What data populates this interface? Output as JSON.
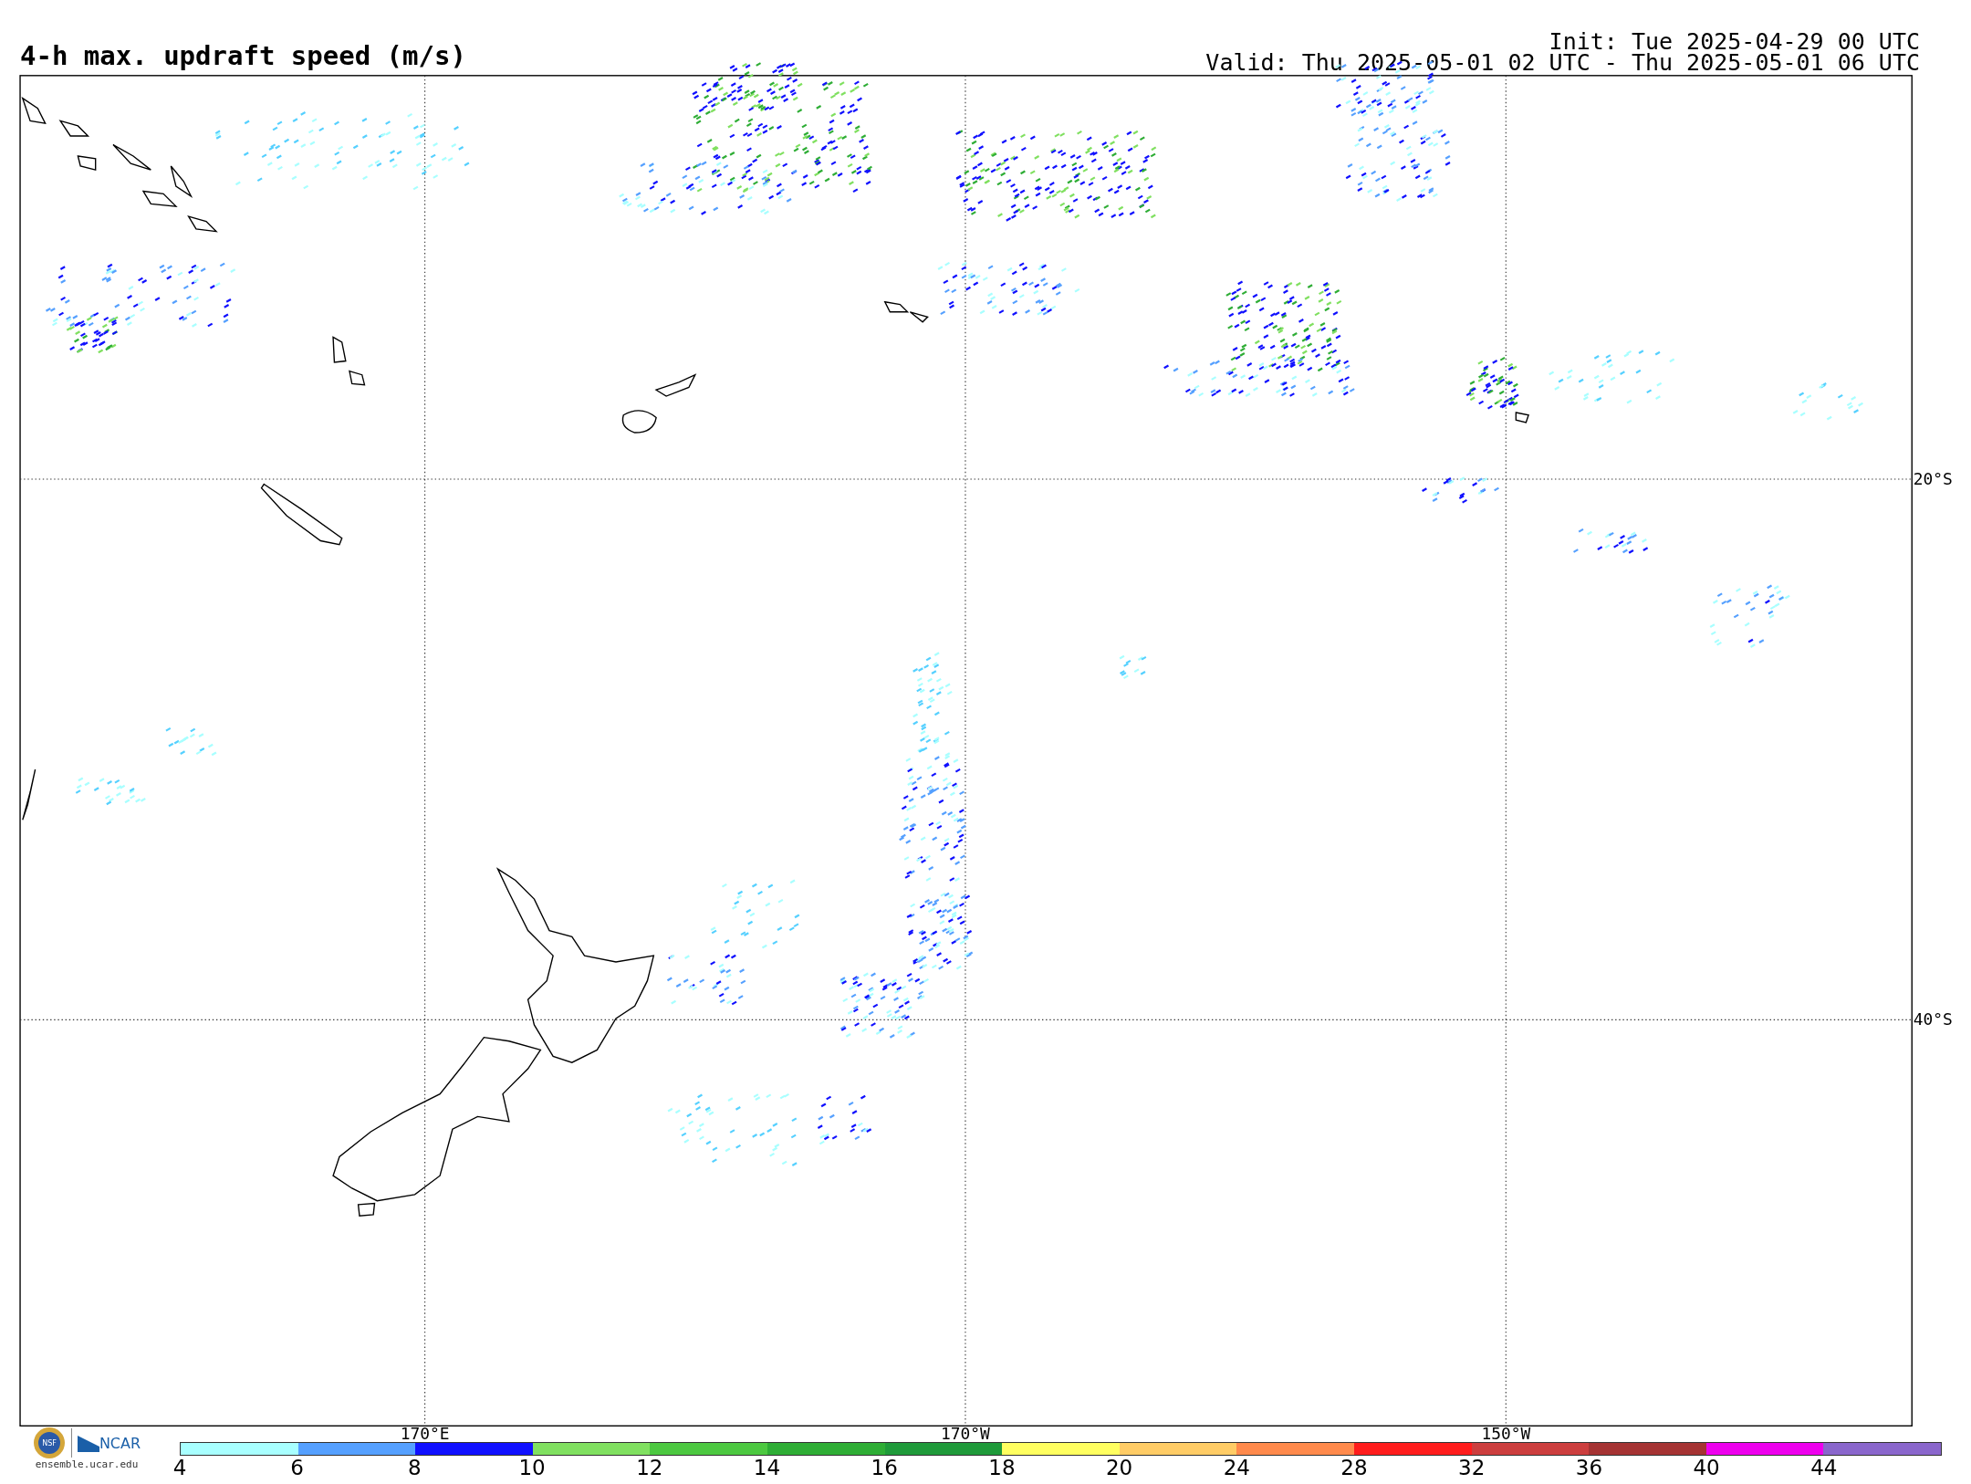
{
  "title": "4-h max. updraft speed (m/s)",
  "init": "Init: Tue 2025-04-29 00 UTC",
  "valid": "Valid: Thu 2025-05-01 02 UTC - Thu 2025-05-01 06 UTC",
  "map": {
    "lat_labels": [
      "20°S",
      "40°S"
    ],
    "lon_labels": [
      "170°E",
      "170°W",
      "150°W"
    ]
  },
  "logo": {
    "seal": "NSF",
    "name": "NCAR",
    "url": "ensemble.ucar.edu"
  },
  "colorbar": {
    "bins": [
      {
        "label": "4",
        "color": "#a8ffff"
      },
      {
        "label": "6",
        "color": "#55a0ff"
      },
      {
        "label": "8",
        "color": "#1010ff"
      },
      {
        "label": "10",
        "color": "#80e060"
      },
      {
        "label": "12",
        "color": "#4cc840"
      },
      {
        "label": "14",
        "color": "#2ead35"
      },
      {
        "label": "16",
        "color": "#1f9a3a"
      },
      {
        "label": "18",
        "color": "#ffff60"
      },
      {
        "label": "20",
        "color": "#ffcc66"
      },
      {
        "label": "24",
        "color": "#ff8a4c"
      },
      {
        "label": "28",
        "color": "#ff1c1c"
      },
      {
        "label": "32",
        "color": "#cc3e3e"
      },
      {
        "label": "36",
        "color": "#a53333"
      },
      {
        "label": "40",
        "color": "#ee00ee"
      },
      {
        "label": "44",
        "color": "#8a66cc"
      }
    ]
  }
}
